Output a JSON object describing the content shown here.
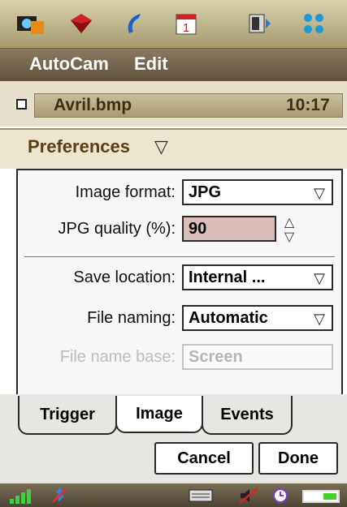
{
  "toolbar": {
    "icons": [
      "camera-app-icon",
      "gem-icon",
      "phone-icon",
      "calendar-icon",
      "media-icon",
      "apps-grid-icon"
    ],
    "calendar_day": "1"
  },
  "menu": {
    "items": [
      "AutoCam",
      "Edit"
    ]
  },
  "file": {
    "name": "Avril.bmp",
    "time": "10:17"
  },
  "preferences": {
    "title": "Preferences"
  },
  "form": {
    "image_format": {
      "label": "Image format:",
      "value": "JPG"
    },
    "jpg_quality": {
      "label": "JPG quality (%):",
      "value": "90"
    },
    "save_location": {
      "label": "Save location:",
      "value": "Internal ..."
    },
    "file_naming": {
      "label": "File naming:",
      "value": "Automatic"
    },
    "file_name_base": {
      "label": "File name base:",
      "value": "Screen"
    }
  },
  "tabs": [
    {
      "label": "Trigger",
      "active": false
    },
    {
      "label": "Image",
      "active": true
    },
    {
      "label": "Events",
      "active": false
    }
  ],
  "buttons": {
    "cancel": "Cancel",
    "done": "Done"
  },
  "status": {
    "icons": [
      "signal-icon",
      "bluetooth-off-icon",
      "keyboard-icon",
      "muted-icon",
      "clock-icon",
      "battery-icon"
    ]
  },
  "colors": {
    "menubar": "#6f6049",
    "jpg_quality_bg": "#d9bdb9",
    "accent_brown": "#5a3f12"
  }
}
